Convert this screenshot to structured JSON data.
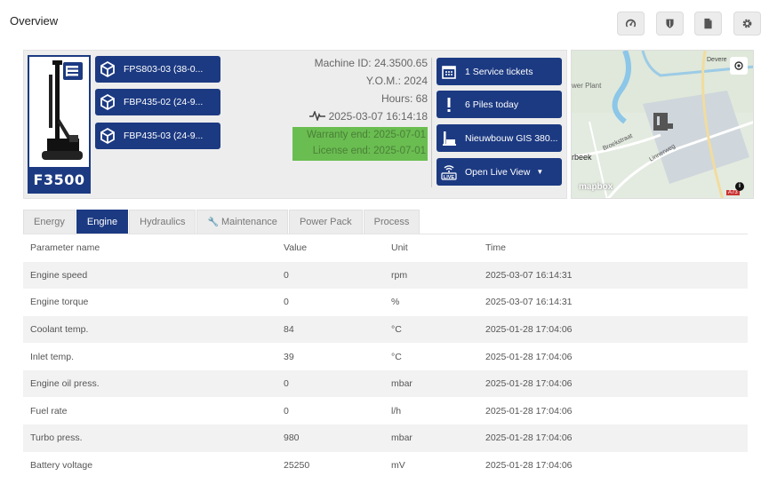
{
  "page": {
    "title": "Overview"
  },
  "toolbar": {
    "buttons": [
      {
        "icon": "gauge-icon"
      },
      {
        "icon": "shield-icon"
      },
      {
        "icon": "document-icon"
      },
      {
        "icon": "gear-icon"
      }
    ]
  },
  "machine": {
    "model": "F3500",
    "attachments": [
      {
        "label": "FPS803-03 (38-0...",
        "icon": "cube-icon"
      },
      {
        "label": "FBP435-02 (24-9...",
        "icon": "cube-icon"
      },
      {
        "label": "FBP435-03 (24-9...",
        "icon": "cube-icon"
      }
    ],
    "machine_id": "Machine ID: 24.3500.65",
    "yom": "Y.O.M.: 2024",
    "hours": "Hours: 68",
    "last_seen": "2025-03-07 16:14:18",
    "warranty_end": "Warranty end: 2025-07-01",
    "license_end": "License end: 2025-07-01",
    "actions": {
      "service_tickets": "1 Service tickets",
      "piles_today": "6 Piles today",
      "project": "Nieuwbouw GIS 380...",
      "live_view": "Open Live View"
    }
  },
  "map": {
    "labels": {
      "power_plant": "wer Plant",
      "street1": "Broekstraat",
      "street2": "Linnerweg",
      "town": "rbeek",
      "top": "Devere",
      "road": "A73",
      "brand": "mapbox"
    }
  },
  "tabs": [
    {
      "label": "Energy",
      "active": false
    },
    {
      "label": "Engine",
      "active": true
    },
    {
      "label": "Hydraulics",
      "active": false
    },
    {
      "label": "Maintenance",
      "active": false
    },
    {
      "label": "Power Pack",
      "active": false
    },
    {
      "label": "Process",
      "active": false
    }
  ],
  "table": {
    "headers": [
      "Parameter name",
      "Value",
      "Unit",
      "Time"
    ],
    "rows": [
      [
        "Engine speed",
        "0",
        "rpm",
        "2025-03-07 16:14:31"
      ],
      [
        "Engine torque",
        "0",
        "%",
        "2025-03-07 16:14:31"
      ],
      [
        "Coolant temp.",
        "84",
        "°C",
        "2025-01-28 17:04:06"
      ],
      [
        "Inlet temp.",
        "39",
        "°C",
        "2025-01-28 17:04:06"
      ],
      [
        "Engine oil press.",
        "0",
        "mbar",
        "2025-01-28 17:04:06"
      ],
      [
        "Fuel rate",
        "0",
        "l/h",
        "2025-01-28 17:04:06"
      ],
      [
        "Turbo press.",
        "980",
        "mbar",
        "2025-01-28 17:04:06"
      ],
      [
        "Battery voltage",
        "25250",
        "mV",
        "2025-01-28 17:04:06"
      ]
    ]
  },
  "colors": {
    "primary": "#1c3a82",
    "warning_green": "#6abd50",
    "accent_orange": "#e8a33a"
  }
}
